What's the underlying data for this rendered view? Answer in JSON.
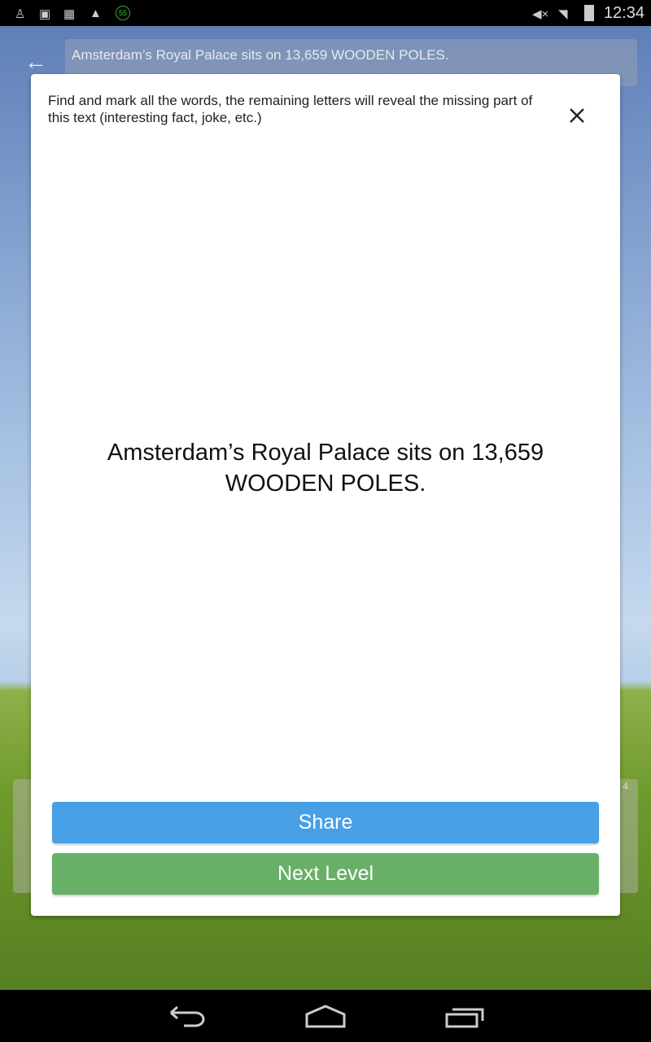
{
  "status_bar": {
    "time": "12:34",
    "notification_badge": "55",
    "icons": [
      "usb-icon",
      "image-icon",
      "app-icon",
      "warning-icon",
      "mute-icon",
      "wifi-icon",
      "battery-icon"
    ]
  },
  "top_bar": {
    "back_icon": "arrow-left-icon",
    "text": "Amsterdam’s Royal Palace sits on 13,659 WOODEN POLES."
  },
  "background_panel": {
    "corner_text": "4"
  },
  "dialog": {
    "instructions": "Find and mark all the words, the remaining letters will reveal the missing part of this text (interesting fact, joke, etc.)",
    "close_icon": "close-icon",
    "fact": "Amsterdam’s Royal Palace sits on 13,659 WOODEN POLES.",
    "share_label": "Share",
    "next_label": "Next Level"
  },
  "colors": {
    "share": "#479fe6",
    "next": "#68b068"
  },
  "nav_bar": {
    "icons": [
      "back-icon",
      "home-icon",
      "recents-icon"
    ]
  }
}
